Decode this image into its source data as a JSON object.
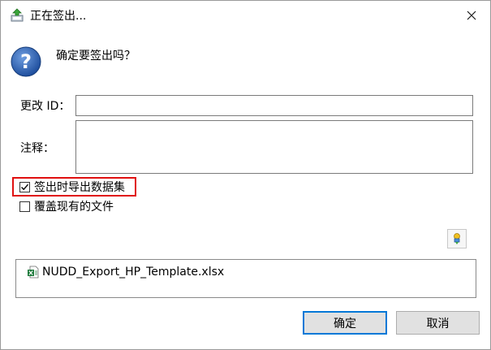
{
  "window": {
    "title": "正在签出..."
  },
  "prompt": {
    "question": "确定要签出吗？"
  },
  "form": {
    "change_id_label": "更改 ID：",
    "change_id_value": "",
    "comment_label": "注释：",
    "comment_value": ""
  },
  "options": {
    "export_dataset_label": "签出时导出数据集",
    "export_dataset_checked": true,
    "overwrite_label": "覆盖现有的文件",
    "overwrite_checked": false
  },
  "files": [
    {
      "name": "NUDD_Export_HP_Template.xlsx",
      "icon": "excel-file-icon"
    }
  ],
  "buttons": {
    "ok_label": "确定",
    "cancel_label": "取消"
  },
  "colors": {
    "highlight_border": "#e01010",
    "default_button_border": "#0078d7",
    "question_icon": "#2a5ba8"
  }
}
